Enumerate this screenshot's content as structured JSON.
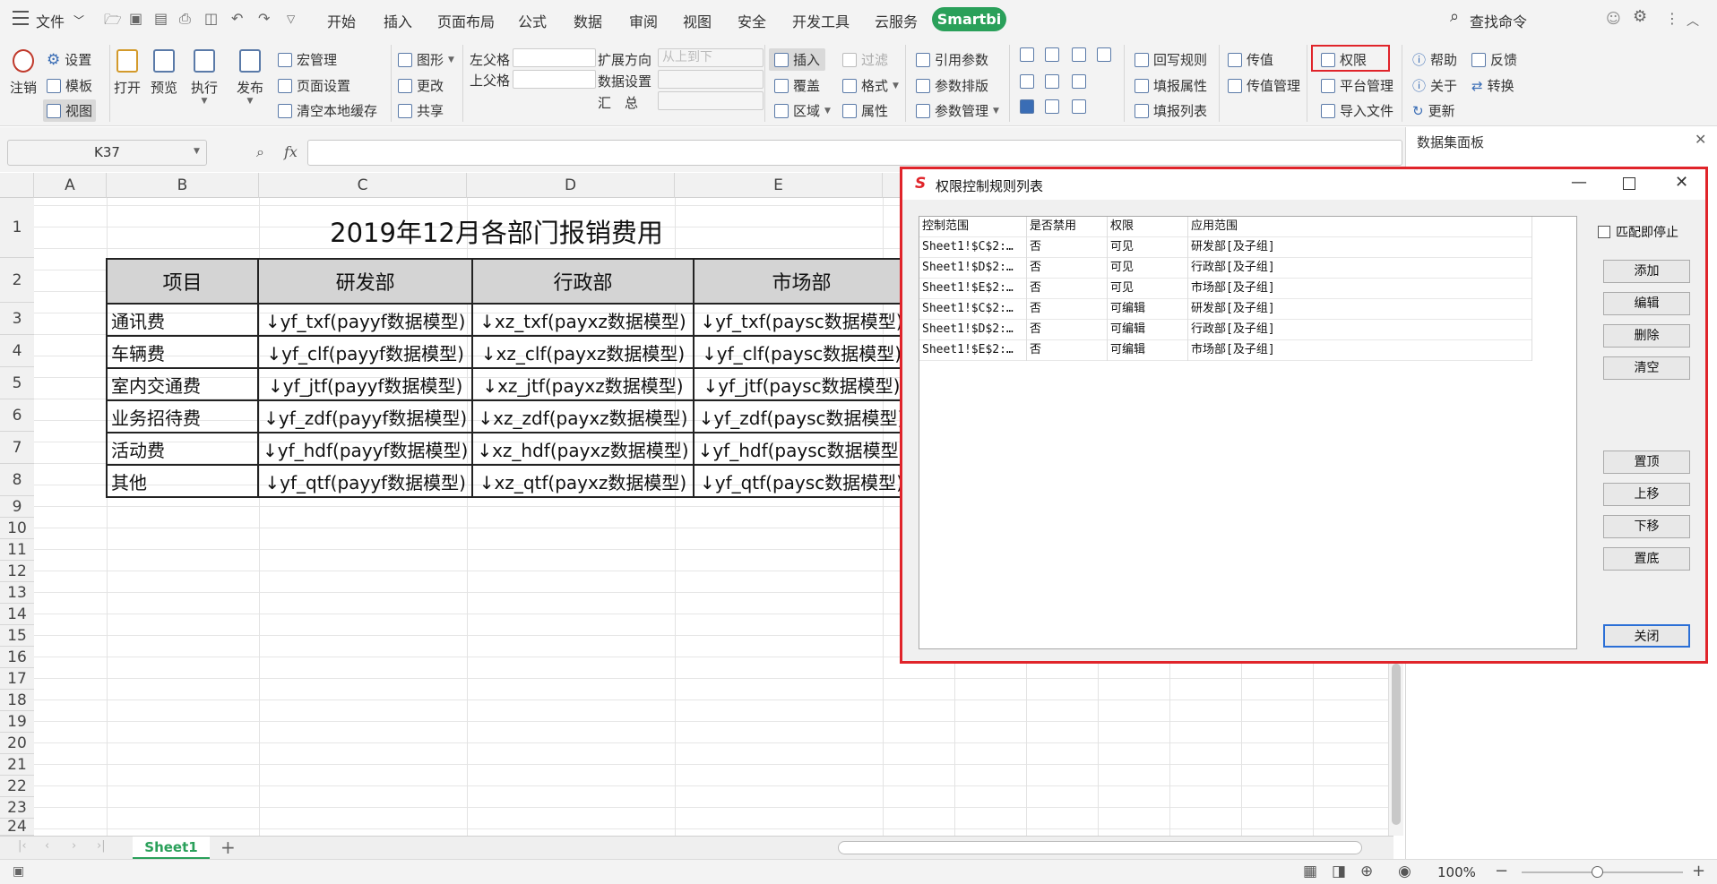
{
  "menubar": {
    "file": "文件",
    "tabs": [
      "开始",
      "插入",
      "页面布局",
      "公式",
      "数据",
      "审阅",
      "视图",
      "安全",
      "开发工具",
      "云服务"
    ],
    "smartbi": "Smartbi",
    "search": "查找命令"
  },
  "ribbon": {
    "logout": "注销",
    "settings": "设置",
    "template": "模板",
    "view": "视图",
    "open": "打开",
    "preview": "预览",
    "execute": "执行",
    "publish": "发布",
    "macro": "宏管理",
    "page_setup": "页面设置",
    "clear_cache": "清空本地缓存",
    "chart": "图形",
    "change": "更改",
    "share": "共享",
    "left_parent": "左父格",
    "top_parent": "上父格",
    "expand_dir": "扩展方向",
    "expand_dir_value": "从上到下",
    "data_settings": "数据设置",
    "summary": "汇　总",
    "insert": "插入",
    "overwrite": "覆盖",
    "region": "区域",
    "filter": "过滤",
    "format": "格式",
    "attribute": "属性",
    "ref_params": "引用参数",
    "param_layout": "参数排版",
    "param_manage": "参数管理",
    "writeback_rules": "回写规则",
    "fill_attr": "填报属性",
    "fill_list": "填报列表",
    "pass_value": "传值",
    "pass_value_manage": "传值管理",
    "permission": "权限",
    "platform_manage": "平台管理",
    "import_file": "导入文件",
    "help": "帮助",
    "feedback": "反馈",
    "about": "关于",
    "convert": "转换",
    "update": "更新"
  },
  "formula": {
    "cell_ref": "K37",
    "fx": "fx"
  },
  "grid": {
    "columns": [
      "A",
      "B",
      "C",
      "D",
      "E"
    ],
    "rows": [
      "1",
      "2",
      "3",
      "4",
      "5",
      "6",
      "7",
      "8",
      "9",
      "10",
      "11",
      "12",
      "13",
      "14",
      "15",
      "16",
      "17",
      "18",
      "19",
      "20",
      "21",
      "22",
      "23",
      "24"
    ],
    "title": "2019年12月各部门报销费用",
    "headers": [
      "项目",
      "研发部",
      "行政部",
      "市场部"
    ],
    "body": [
      [
        "通讯费",
        "↓yf_txf(payyf数据模型)",
        "↓xz_txf(payxz数据模型)",
        "↓yf_txf(paysc数据模型)"
      ],
      [
        "车辆费",
        "↓yf_clf(payyf数据模型)",
        "↓xz_clf(payxz数据模型)",
        "↓yf_clf(paysc数据模型)"
      ],
      [
        "室内交通费",
        "↓yf_jtf(payyf数据模型)",
        "↓xz_jtf(payxz数据模型)",
        "↓yf_jtf(paysc数据模型)"
      ],
      [
        "业务招待费",
        "↓yf_zdf(payyf数据模型)",
        "↓xz_zdf(payxz数据模型)",
        "↓yf_zdf(paysc数据模型)"
      ],
      [
        "活动费",
        "↓yf_hdf(payyf数据模型)",
        "↓xz_hdf(payxz数据模型)",
        "↓yf_hdf(paysc数据模型)"
      ],
      [
        "其他",
        "↓yf_qtf(payyf数据模型)",
        "↓xz_qtf(payxz数据模型)",
        "↓yf_qtf(paysc数据模型)"
      ]
    ]
  },
  "sheet_tab": "Sheet1",
  "status": {
    "zoom": "100%"
  },
  "right_panel": {
    "title": "数据集面板"
  },
  "dialog": {
    "title": "权限控制规则列表",
    "columns": [
      "控制范围",
      "是否禁用",
      "权限",
      "应用范围"
    ],
    "rows": [
      [
        "Sheet1!$C$2:…",
        "否",
        "可见",
        "研发部[及子组]"
      ],
      [
        "Sheet1!$D$2:…",
        "否",
        "可见",
        "行政部[及子组]"
      ],
      [
        "Sheet1!$E$2:…",
        "否",
        "可见",
        "市场部[及子组]"
      ],
      [
        "Sheet1!$C$2:…",
        "否",
        "可编辑",
        "研发部[及子组]"
      ],
      [
        "Sheet1!$D$2:…",
        "否",
        "可编辑",
        "行政部[及子组]"
      ],
      [
        "Sheet1!$E$2:…",
        "否",
        "可编辑",
        "市场部[及子组]"
      ]
    ],
    "match_stop": "匹配即停止",
    "buttons": {
      "add": "添加",
      "edit": "编辑",
      "delete": "删除",
      "clear": "清空",
      "top": "置顶",
      "up": "上移",
      "down": "下移",
      "bottom": "置底",
      "close": "关闭"
    }
  },
  "colors": {
    "accent_green": "#2aa05a",
    "highlight_red": "#e0242a",
    "sheet_tab_green": "#2aa05a"
  }
}
